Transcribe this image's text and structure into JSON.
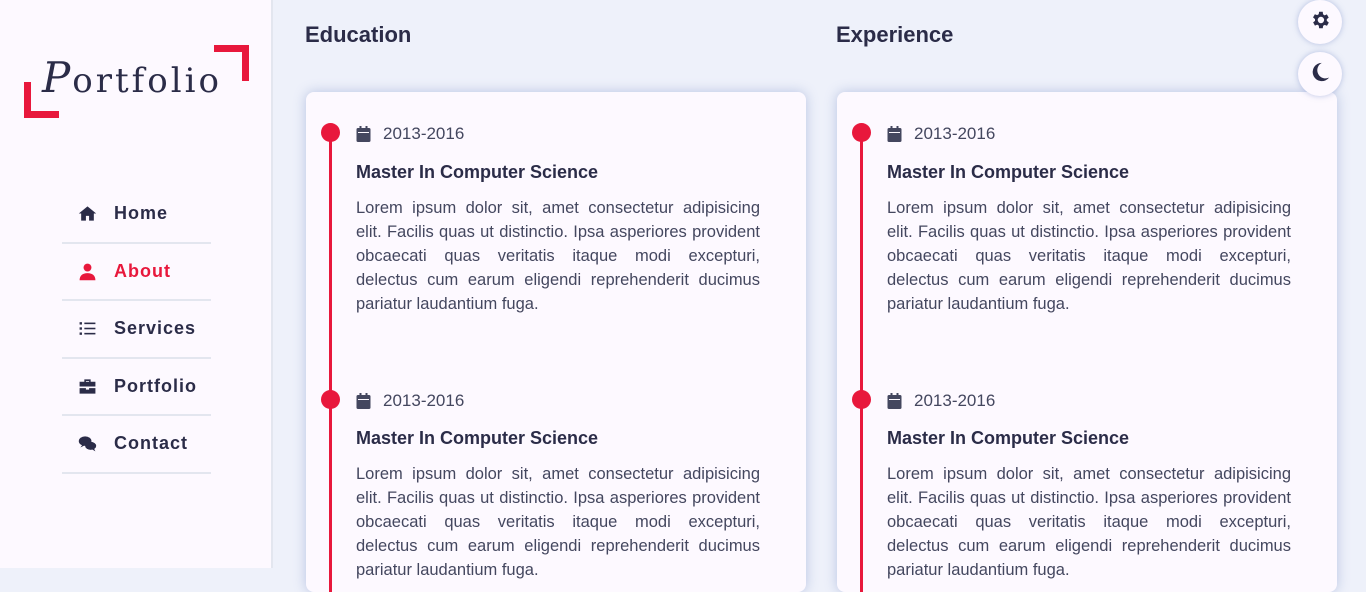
{
  "brand": {
    "logo_initial": "P",
    "logo_rest": "ortfolio",
    "accent": "#e8183c"
  },
  "nav": {
    "items": [
      {
        "label": "Home",
        "icon": "home-icon",
        "active": false
      },
      {
        "label": "About",
        "icon": "user-icon",
        "active": true
      },
      {
        "label": "Services",
        "icon": "list-icon",
        "active": false
      },
      {
        "label": "Portfolio",
        "icon": "briefcase-icon",
        "active": false
      },
      {
        "label": "Contact",
        "icon": "comments-icon",
        "active": false
      }
    ]
  },
  "education": {
    "title": "Education",
    "entries": [
      {
        "date": "2013-2016",
        "title": "Master In Computer Science",
        "desc": "Lorem ipsum dolor sit, amet consectetur adipisicing elit. Facilis quas ut distinctio. Ipsa asperiores provident obcaecati quas veritatis itaque modi excepturi, delectus cum earum eligendi reprehenderit ducimus pariatur laudantium fuga."
      },
      {
        "date": "2013-2016",
        "title": "Master In Computer Science",
        "desc": "Lorem ipsum dolor sit, amet consectetur adipisicing elit. Facilis quas ut distinctio. Ipsa asperiores provident obcaecati quas veritatis itaque modi excepturi, delectus cum earum eligendi reprehenderit ducimus pariatur laudantium fuga."
      }
    ]
  },
  "experience": {
    "title": "Experience",
    "entries": [
      {
        "date": "2013-2016",
        "title": "Master In Computer Science",
        "desc": "Lorem ipsum dolor sit, amet consectetur adipisicing elit. Facilis quas ut distinctio. Ipsa asperiores provident obcaecati quas veritatis itaque modi excepturi, delectus cum earum eligendi reprehenderit ducimus pariatur laudantium fuga."
      },
      {
        "date": "2013-2016",
        "title": "Master In Computer Science",
        "desc": "Lorem ipsum dolor sit, amet consectetur adipisicing elit. Facilis quas ut distinctio. Ipsa asperiores provident obcaecati quas veritatis itaque modi excepturi, delectus cum earum eligendi reprehenderit ducimus pariatur laudantium fuga."
      }
    ]
  },
  "controls": {
    "settings_icon": "gear-icon",
    "theme_icon": "moon-icon"
  }
}
